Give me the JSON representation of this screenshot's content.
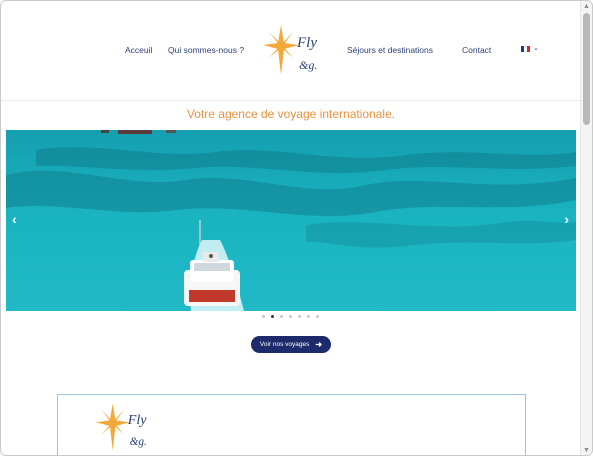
{
  "nav": {
    "items": [
      {
        "label": "Acceuil"
      },
      {
        "label": "Qui sommes-nous ?"
      },
      {
        "label": "Séjours et destinations"
      },
      {
        "label": "Contact"
      }
    ],
    "language": {
      "icon": "french-flag-icon",
      "colors": [
        "#1e3a8a",
        "#ffffff",
        "#d62828"
      ]
    }
  },
  "logo": {
    "text_top": "Fly",
    "text_bottom": "&g.",
    "star_color": "#f2a93b",
    "text_color": "#2a3f73"
  },
  "tagline": "Votre agence de voyage internationale.",
  "slider": {
    "slides_count": 7,
    "active_slide": 2,
    "prev_icon": "chevron-left-icon",
    "next_icon": "chevron-right-icon"
  },
  "cta": {
    "label": "Voir nos voyages",
    "icon": "arrow-right-icon"
  },
  "colors": {
    "accent": "#e8913f",
    "primary": "#1d2a6b",
    "sea": "#1fb0bd"
  }
}
